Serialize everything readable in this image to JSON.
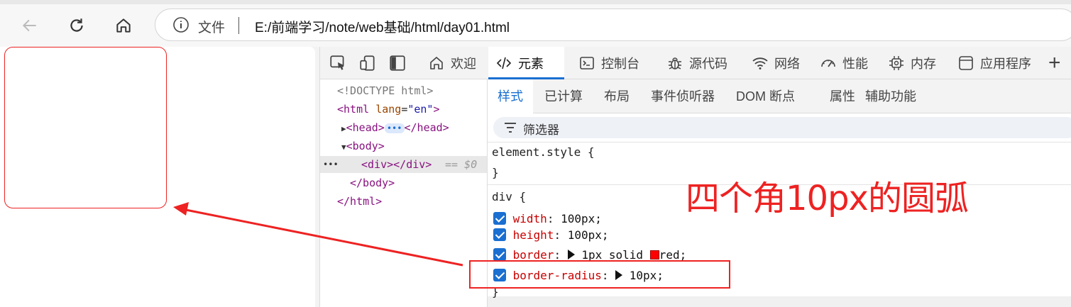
{
  "browser": {
    "back_icon": "arrow-left-icon",
    "refresh_icon": "refresh-icon",
    "home_icon": "home-icon",
    "address": {
      "info_icon": "info-icon",
      "label": "文件",
      "url": "E:/前端学习/note/web基础/html/day01.html"
    }
  },
  "devtools": {
    "tabs": [
      {
        "label": "欢迎",
        "icon": "home-icon"
      },
      {
        "label": "元素",
        "icon": "code-icon"
      },
      {
        "label": "控制台",
        "icon": "console-icon"
      },
      {
        "label": "源代码",
        "icon": "bug-icon"
      },
      {
        "label": "网络",
        "icon": "wifi-icon"
      },
      {
        "label": "性能",
        "icon": "gauge-icon"
      },
      {
        "label": "内存",
        "icon": "chip-icon"
      },
      {
        "label": "应用程序",
        "icon": "app-icon"
      }
    ],
    "active_tab": "元素",
    "tree": {
      "doctype": "<!DOCTYPE html>",
      "html_open": "<html",
      "lang_attr": "lang",
      "lang_value": "\"en\"",
      "html_close_bracket": ">",
      "head_open": "<head>",
      "head_close": "</head>",
      "body_open": "<body>",
      "div_node": "<div></div>",
      "div_ref": "== $0",
      "body_close": "</body>",
      "html_close": "</html>",
      "ellipsis": "•••"
    },
    "styles": {
      "subtabs": [
        "样式",
        "已计算",
        "布局",
        "事件侦听器",
        "DOM 断点",
        "属性",
        "辅助功能"
      ],
      "active_subtab": "样式",
      "filter_label": "筛选器",
      "element_style_open": "element.style {",
      "element_style_close": "}",
      "div_open": "div {",
      "div_close": "}",
      "props": [
        {
          "name": "width",
          "value": "100px;"
        },
        {
          "name": "height",
          "value": "100px;"
        },
        {
          "name": "border",
          "value_pre": "1px solid",
          "value_post": "red;"
        },
        {
          "name": "border-radius",
          "value": "10px;"
        }
      ]
    }
  },
  "annotation": {
    "text": "四个角10px的圆弧",
    "color": "#e22222"
  }
}
